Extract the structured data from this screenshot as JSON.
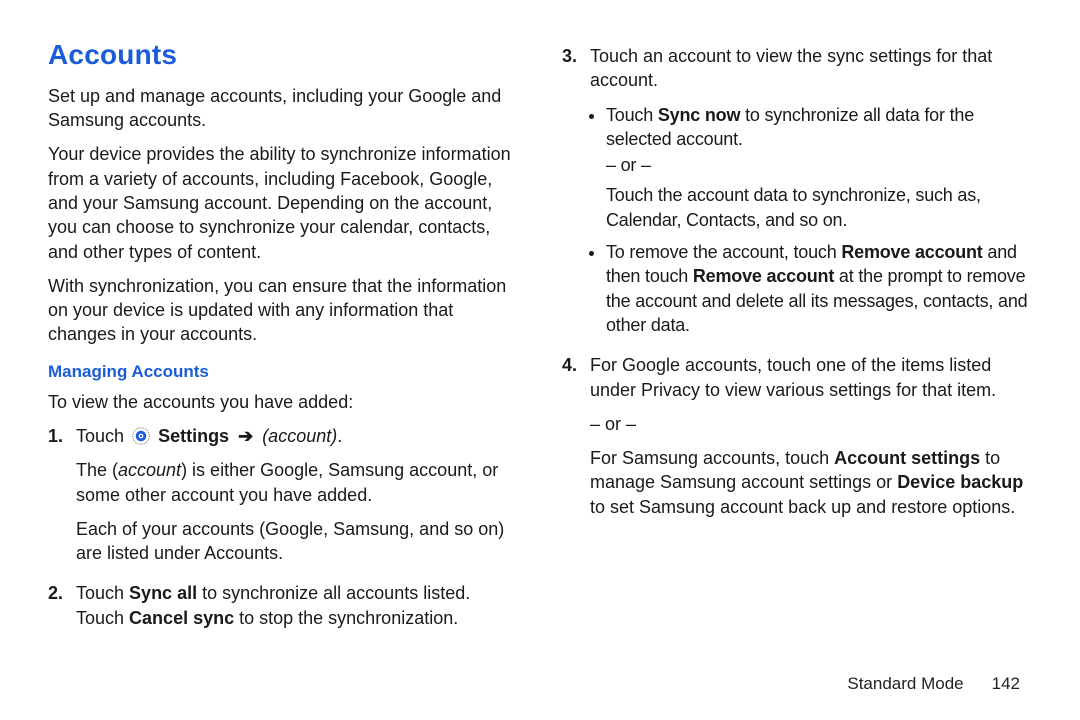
{
  "heading": "Accounts",
  "intro_para_1": "Set up and manage accounts, including your Google and Samsung accounts.",
  "intro_para_2": "Your device provides the ability to synchronize information from a variety of accounts, including Facebook, Google, and your Samsung account. Depending on the account, you can choose to synchronize your calendar, contacts, and other types of content.",
  "intro_para_3": "With synchronization, you can ensure that the information on your device is updated with any information that changes in your accounts.",
  "subhead": "Managing Accounts",
  "sub_intro": "To view the accounts you have added:",
  "steps": {
    "s1": {
      "num": "1.",
      "touch_word": "Touch ",
      "settings_word": " Settings ",
      "arrow": "➔",
      "account_word": " (account)",
      "period": ".",
      "p2_pre": "The (",
      "p2_mid": "account",
      "p2_post": ") is either Google, Samsung account, or some other account you have added.",
      "p3": "Each of your accounts (Google, Samsung, and so on) are listed under Accounts."
    },
    "s2": {
      "num": "2.",
      "pre": "Touch ",
      "bold1": "Sync all",
      "mid": " to synchronize all accounts listed. Touch ",
      "bold2": "Cancel sync",
      "post": " to stop the synchronization."
    },
    "s3": {
      "num": "3.",
      "line1": "Touch an account to view the sync settings for that account.",
      "b1_pre": "Touch ",
      "b1_bold": "Sync now",
      "b1_post": " to synchronize all data for the selected account.",
      "or": "– or –",
      "b1_after": "Touch the account data to synchronize, such as, Calendar, Contacts, and so on.",
      "b2_pre": "To remove the account, touch ",
      "b2_bold1": "Remove account",
      "b2_mid": " and then touch ",
      "b2_bold2": "Remove account",
      "b2_post": " at the prompt to remove the account and delete all its messages, contacts, and other data."
    },
    "s4": {
      "num": "4.",
      "p1": "For Google accounts, touch one of the items listed under Privacy to view various settings for that item.",
      "or": "– or –",
      "p2_pre": "For Samsung accounts, touch ",
      "p2_b1": "Account settings",
      "p2_mid": " to manage Samsung account settings or ",
      "p2_b2": "Device backup",
      "p2_post": " to set Samsung account back up and restore options."
    }
  },
  "footer": {
    "mode": "Standard Mode",
    "page": "142"
  }
}
